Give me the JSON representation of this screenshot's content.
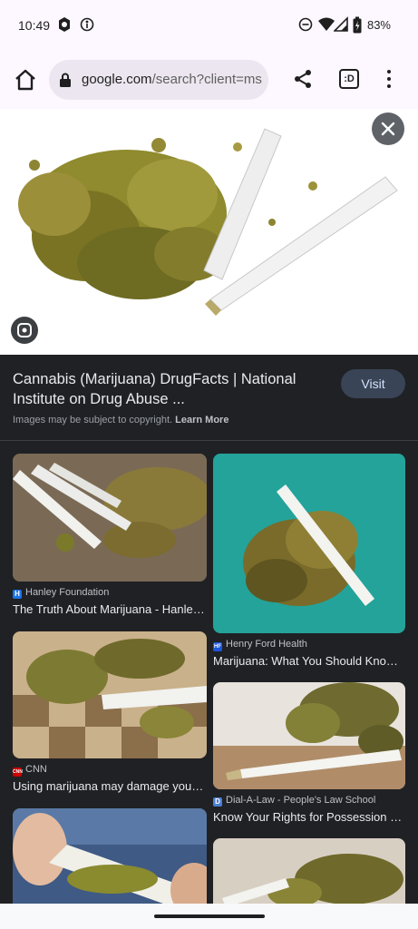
{
  "status_bar": {
    "time": "10:49",
    "battery": "83%"
  },
  "browser": {
    "url_domain": "google.com",
    "url_path": "/search?client=ms",
    "tab_label": ":D"
  },
  "result": {
    "title": "Cannabis (Marijuana) DrugFacts | National Institute on Drug Abuse ...",
    "visit_label": "Visit",
    "copyright": "Images may be subject to copyright.",
    "learn_more": "Learn More"
  },
  "grid": [
    {
      "source": "Hanley Foundation",
      "favicon": "H",
      "favicon_color": "#1a73e8",
      "caption": "The Truth About Marijuana - Hanley..."
    },
    {
      "source": "Henry Ford Health",
      "favicon": "HF",
      "favicon_color": "#1a56db",
      "caption": "Marijuana: What You Should Know ..."
    },
    {
      "source": "CNN",
      "favicon": "CNN",
      "favicon_color": "#cc0000",
      "caption": "Using marijuana may damage your ..."
    },
    {
      "source": "Dial-A-Law - People's Law School",
      "favicon": "D",
      "favicon_color": "#4a7fd6",
      "caption": "Know Your Rights for Possession o..."
    }
  ]
}
